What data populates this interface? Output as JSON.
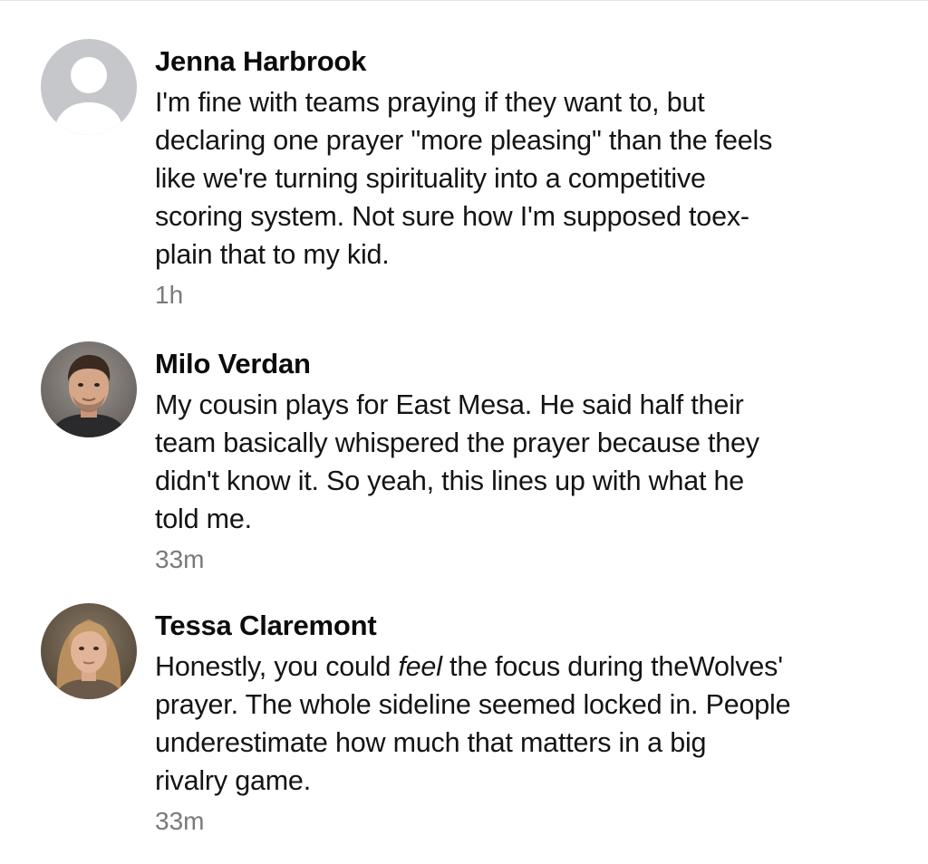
{
  "comments": [
    {
      "author": "Jenna Harbrook",
      "avatar_icon": "default-user-icon",
      "lines": [
        "I'm fine with teams praying if they want to, but",
        "declaring one prayer \"more pleasing\" than the feels",
        "like we're turning spirituality into a competitive",
        "scoring system. Not sure how I'm supposed toex-",
        "plain that to my kid."
      ],
      "time": "1h"
    },
    {
      "author": "Milo Verdan",
      "avatar_icon": "man-profile-photo",
      "lines": [
        "My cousin plays for East Mesa. He said half their",
        "team basically whispered the prayer because they",
        "didn't know it. So yeah, this lines up with what he",
        "told me."
      ],
      "time": "33m"
    },
    {
      "author": "Tessa Claremont",
      "avatar_icon": "woman-profile-photo",
      "line1": {
        "before": "Honestly, you could ",
        "emphasis": "feel",
        "after": " the focus during theWolves'"
      },
      "lines": [
        "prayer. The whole sideline seemed locked in. People",
        "underestimate how much that matters in a big",
        "rivalry game."
      ],
      "time": "33m"
    }
  ]
}
